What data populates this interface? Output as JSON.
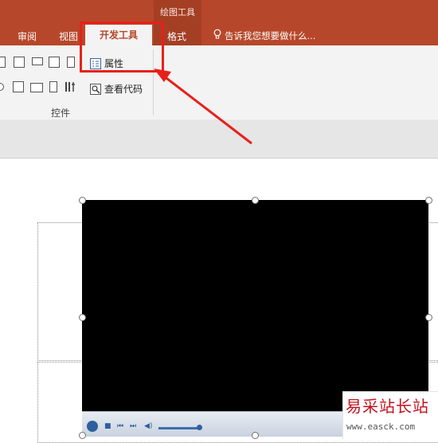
{
  "ribbon": {
    "contextual_group": "绘图工具",
    "tabs": [
      {
        "label": "审阅"
      },
      {
        "label": "视图"
      },
      {
        "label": "开发工具",
        "active": true
      },
      {
        "label": "格式"
      }
    ],
    "tell_me": "告诉我您想要做什么...",
    "tell_me_icon": "lightbulb-icon"
  },
  "controls_group": {
    "label": "控件",
    "commands": [
      {
        "label": "属性",
        "icon": "properties-icon"
      },
      {
        "label": "查看代码",
        "icon": "view-code-icon"
      }
    ]
  },
  "colors": {
    "ribbon": "#b7472a",
    "ribbon_body": "#f3f3f3",
    "annotation": "#e8201a"
  },
  "watermark": {
    "title": "易采站长站",
    "url": "www.easck.com"
  }
}
